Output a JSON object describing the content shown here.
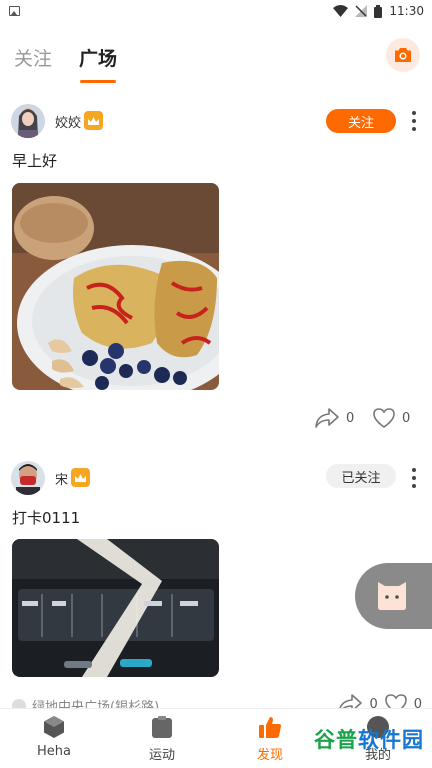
{
  "status_bar": {
    "time": "11:30"
  },
  "header": {
    "tabs": [
      {
        "label": "关注",
        "active": false
      },
      {
        "label": "广场",
        "active": true
      }
    ]
  },
  "posts": [
    {
      "username": "姣姣",
      "follow_label": "关注",
      "text": "早上好",
      "share_count": "0",
      "like_count": "0"
    },
    {
      "username": "宋",
      "follow_label": "已关注",
      "text": "打卡0111",
      "location": "绿地中央广场(银杉路)",
      "share_count": "0",
      "like_count": "0"
    }
  ],
  "bottom_nav": [
    {
      "label": "Heha"
    },
    {
      "label": "运动"
    },
    {
      "label": "发现",
      "active": true
    },
    {
      "label": "我的"
    }
  ],
  "watermark": {
    "part1": "谷普",
    "part2": "软件园"
  },
  "colors": {
    "accent": "#ff6a00",
    "crown": "#f5a623"
  }
}
